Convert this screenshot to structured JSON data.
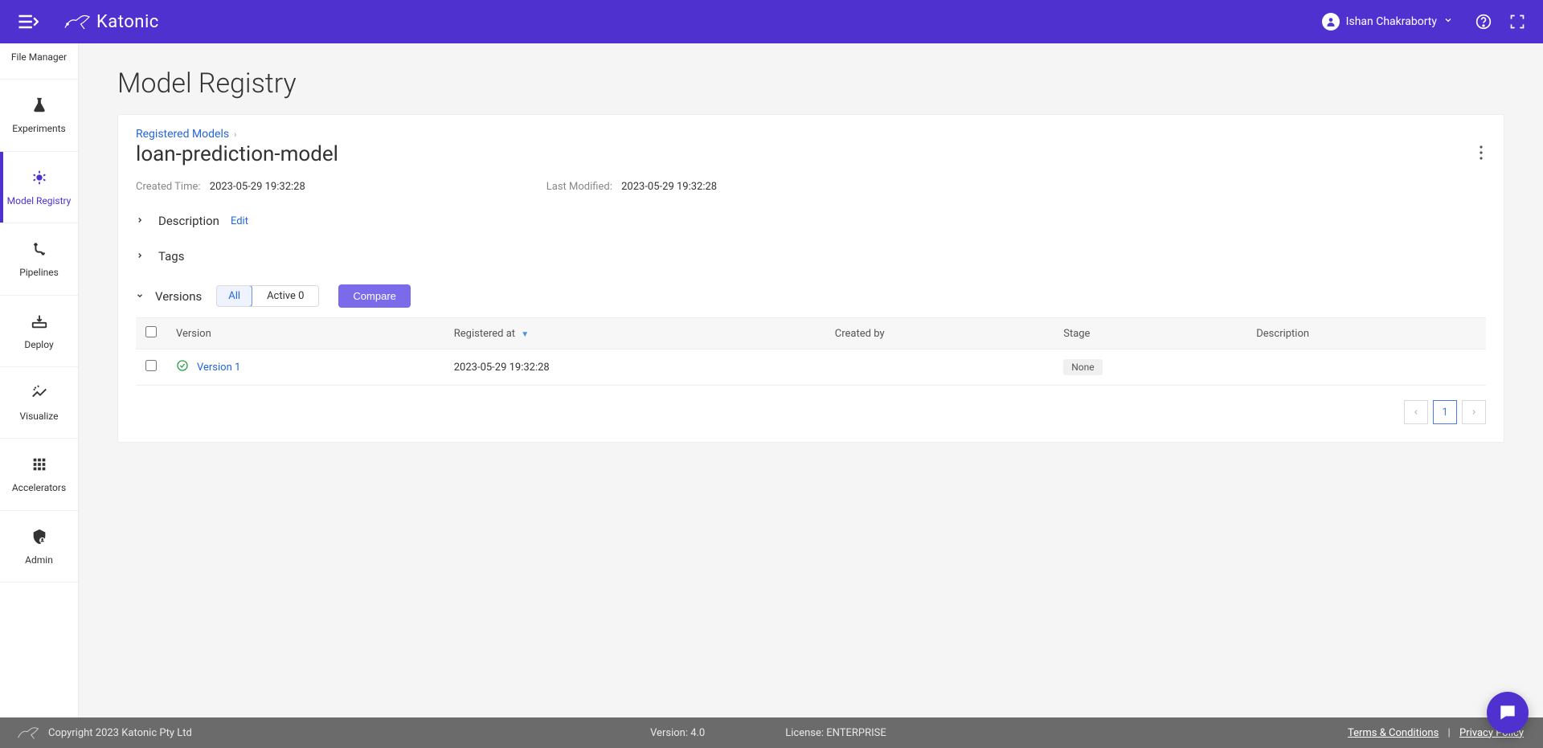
{
  "header": {
    "brand_name": "Katonic",
    "user_name": "Ishan Chakraborty"
  },
  "sidebar": {
    "items": [
      {
        "label": "File Manager"
      },
      {
        "label": "Experiments"
      },
      {
        "label": "Model Registry"
      },
      {
        "label": "Pipelines"
      },
      {
        "label": "Deploy"
      },
      {
        "label": "Visualize"
      },
      {
        "label": "Accelerators"
      },
      {
        "label": "Admin"
      }
    ]
  },
  "page": {
    "title": "Model Registry",
    "breadcrumb_root": "Registered Models",
    "model_name": "loan-prediction-model",
    "created_label": "Created Time:",
    "created_value": "2023-05-29 19:32:28",
    "modified_label": "Last Modified:",
    "modified_value": "2023-05-29 19:32:28",
    "description_label": "Description",
    "edit_label": "Edit",
    "tags_label": "Tags",
    "versions_label": "Versions",
    "filter_all": "All",
    "filter_active": "Active 0",
    "compare_label": "Compare"
  },
  "table": {
    "columns": {
      "version": "Version",
      "registered_at": "Registered at",
      "created_by": "Created by",
      "stage": "Stage",
      "description": "Description"
    },
    "rows": [
      {
        "version": "Version 1",
        "registered_at": "2023-05-29 19:32:28",
        "created_by": "",
        "stage": "None",
        "description": ""
      }
    ]
  },
  "pagination": {
    "current": "1"
  },
  "footer": {
    "copyright": "Copyright 2023 Katonic Pty Ltd",
    "version": "Version: 4.0",
    "license": "License: ENTERPRISE",
    "terms": "Terms & Conditions",
    "privacy": "Privacy Policy"
  }
}
